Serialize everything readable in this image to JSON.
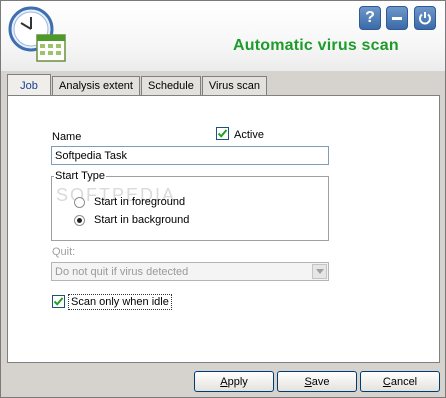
{
  "header": {
    "title": "Automatic virus scan",
    "help_label": "?",
    "icons": [
      "clock-calendar-icon",
      "help-icon",
      "minimize-icon",
      "power-icon"
    ]
  },
  "tabs": [
    {
      "label": "Job",
      "active": true
    },
    {
      "label": "Analysis extent",
      "active": false
    },
    {
      "label": "Schedule",
      "active": false
    },
    {
      "label": "Virus scan",
      "active": false
    }
  ],
  "job": {
    "name_label": "Name",
    "name_value": "Softpedia Task",
    "active_label": "Active",
    "active_checked": true,
    "start_type": {
      "legend": "Start Type",
      "foreground_label": "Start in foreground",
      "background_label": "Start in background",
      "selected": "background"
    },
    "quit_label": "Quit:",
    "quit_value": "Do not quit if virus detected",
    "idle_label": "Scan only when idle",
    "idle_checked": true
  },
  "buttons": {
    "apply": {
      "first": "A",
      "rest": "pply"
    },
    "save": {
      "first": "S",
      "rest": "ave"
    },
    "cancel": {
      "first": "C",
      "rest": "ancel"
    }
  },
  "colors": {
    "title": "#1e9c2b",
    "active_tab_text": "#1a3f8f",
    "checkmark": "#21a121",
    "header_button": "#3a6aa8"
  }
}
